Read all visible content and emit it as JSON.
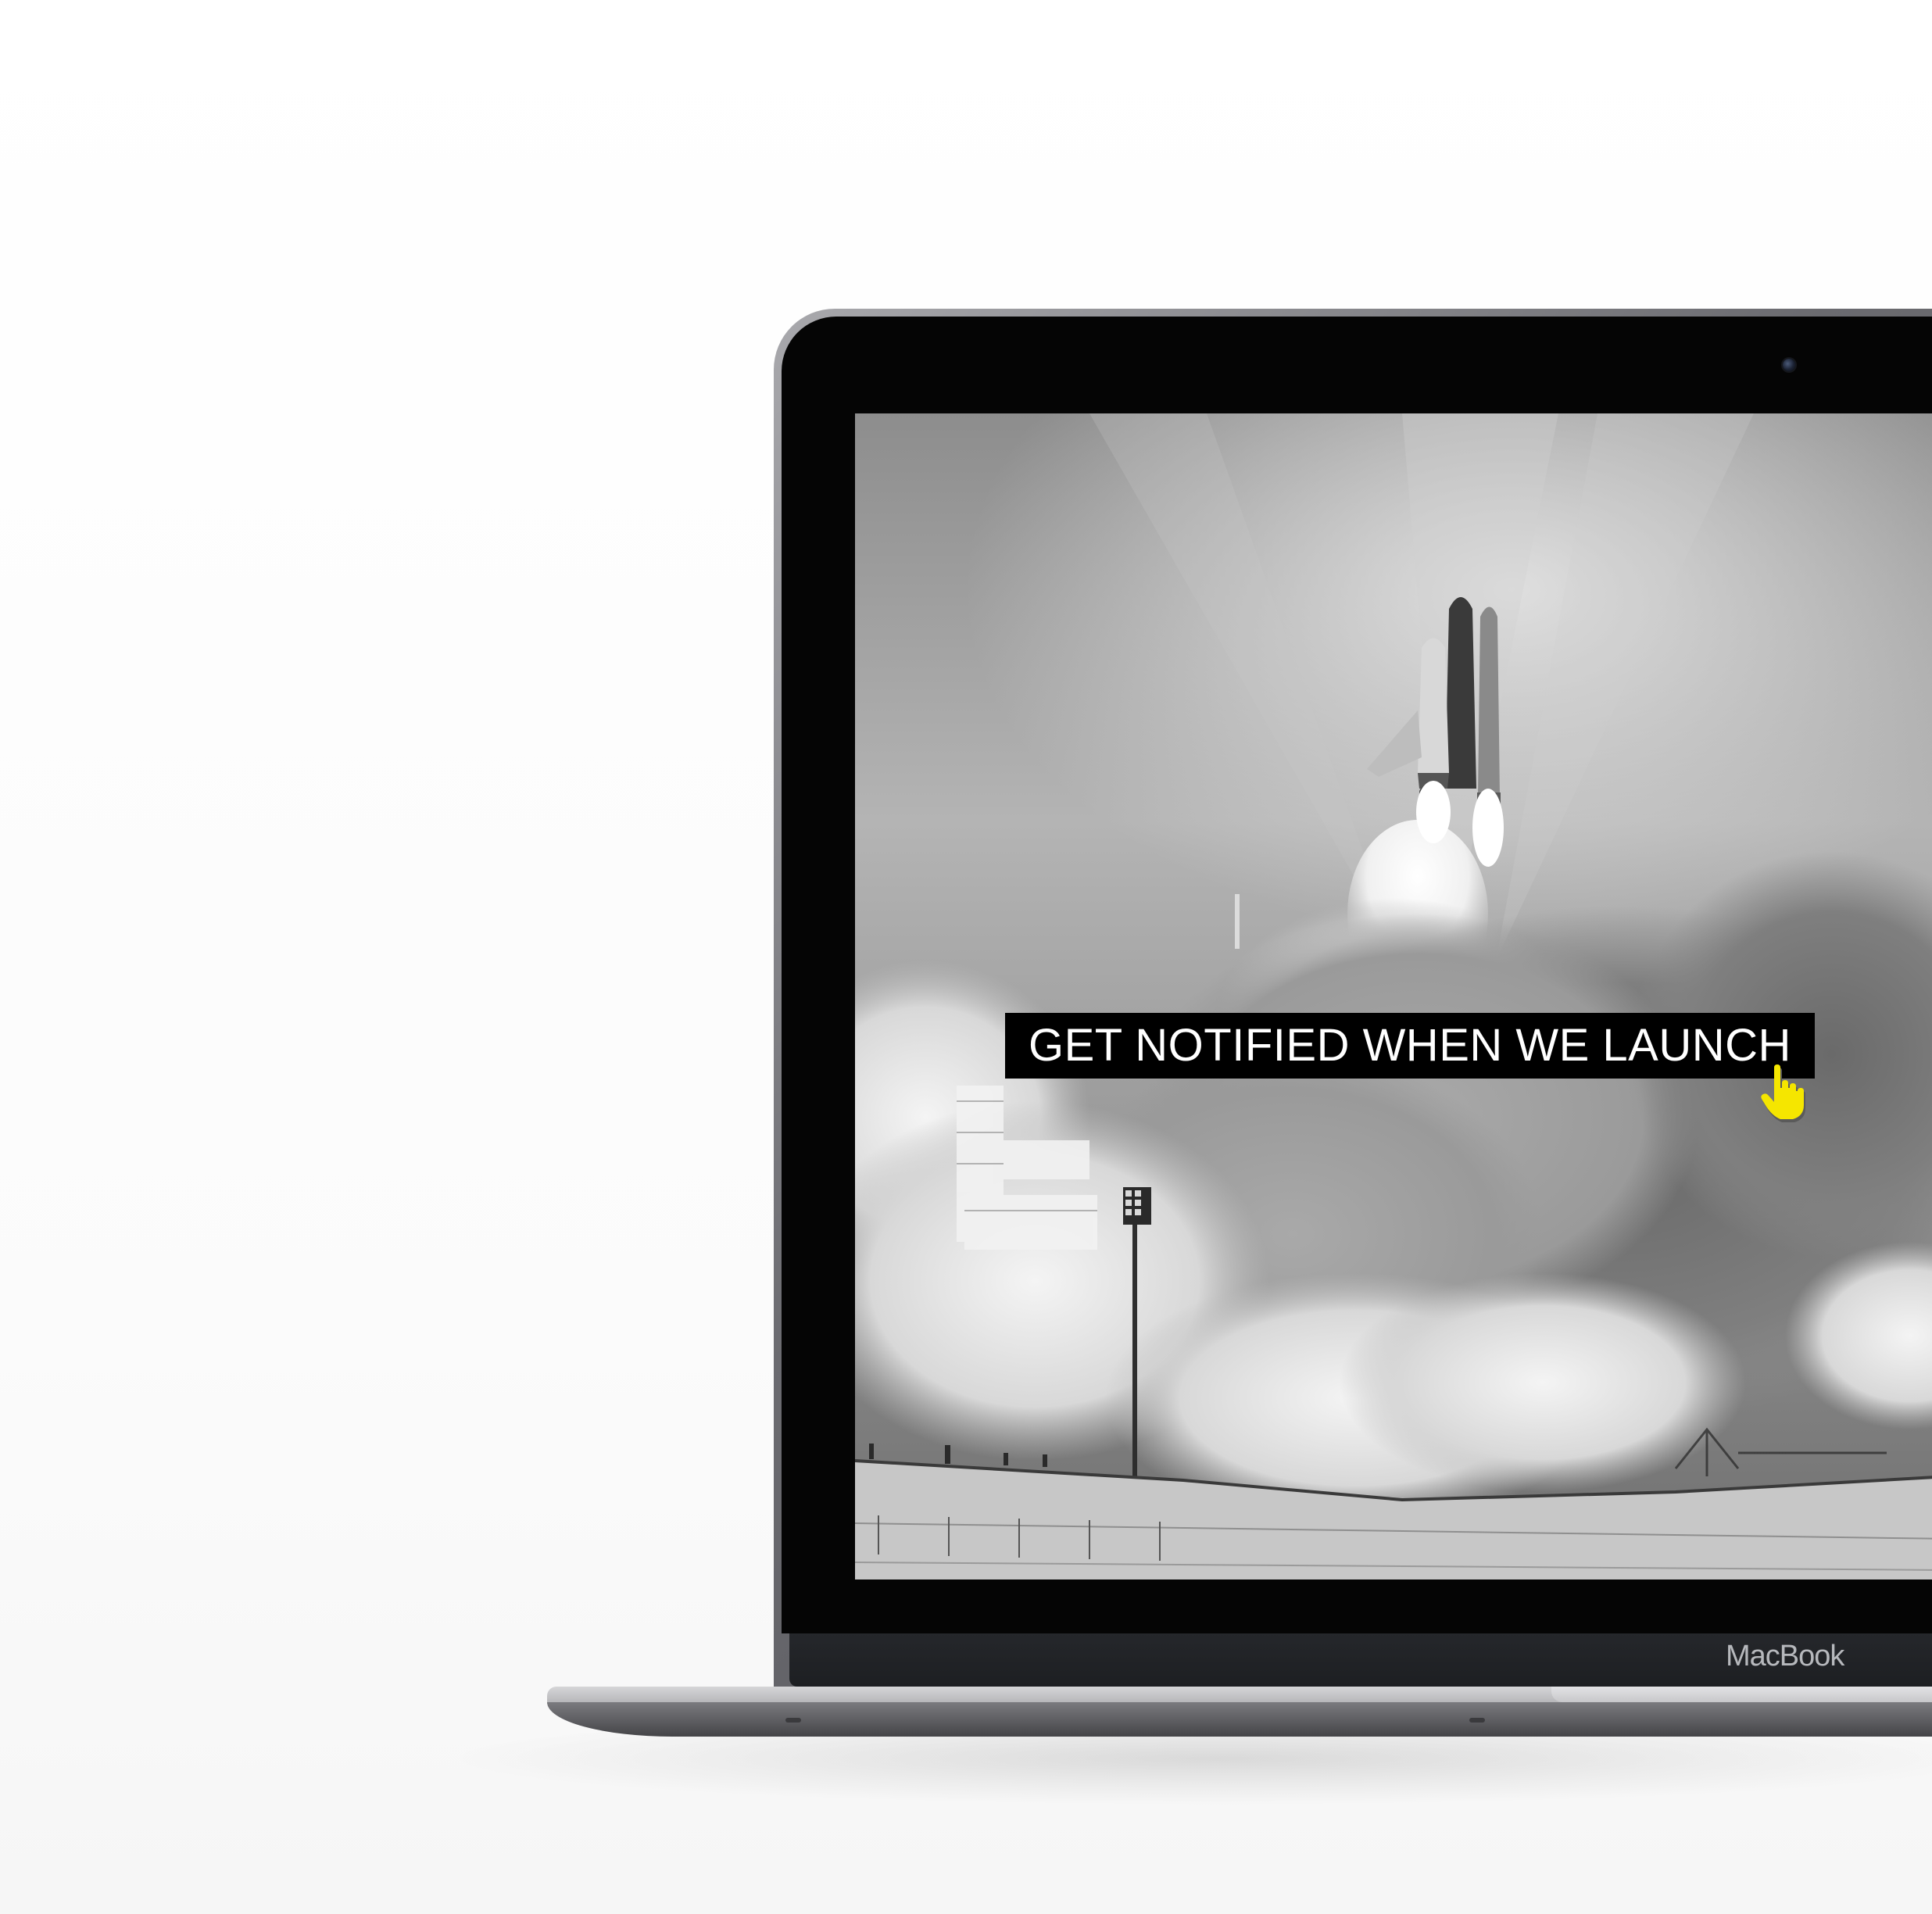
{
  "device": {
    "brand_label": "MacBook"
  },
  "screen": {
    "cta_label": "GET NOTIFIED WHEN WE LAUNCH",
    "cursor_icon": "hand-pointer-icon",
    "cursor_color": "#f5e600",
    "background_image": "space-shuttle-launch-photo"
  }
}
